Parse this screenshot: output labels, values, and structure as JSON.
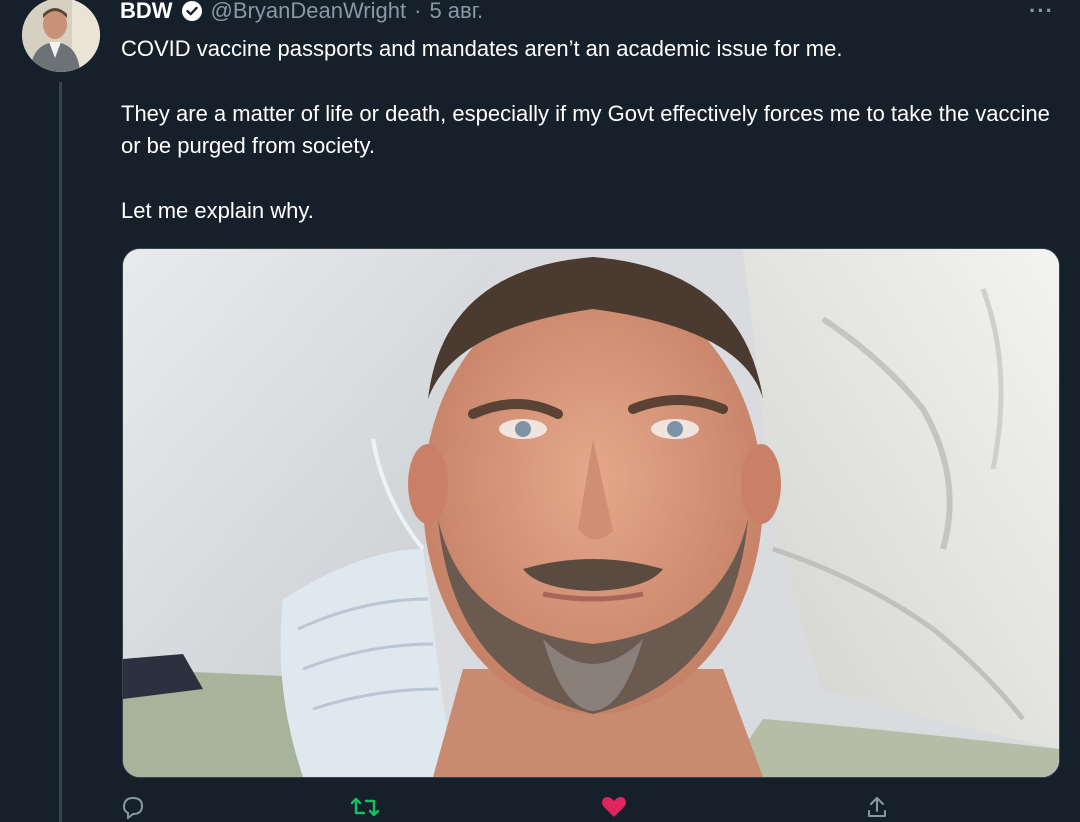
{
  "tweet": {
    "display_name": "BDW",
    "handle": "@BryanDeanWright",
    "separator": "·",
    "date": "5 авг.",
    "more_label": "···",
    "text_paragraphs": [
      "COVID vaccine passports and mandates aren’t an academic issue for me.",
      "They are a matter of life or death, especially if my Govt effectively forces me to take the vaccine or be purged from society.",
      "Let me explain why."
    ]
  },
  "actions": {
    "reply_icon": "reply-icon",
    "retweet_icon": "retweet-icon",
    "like_icon": "heart-icon",
    "share_icon": "share-icon"
  },
  "colors": {
    "background": "#15202b",
    "secondary_text": "#8899a6",
    "verified_blue": "#1da1f2",
    "like_red": "#e0245e",
    "retweet_green": "#17bf63"
  }
}
